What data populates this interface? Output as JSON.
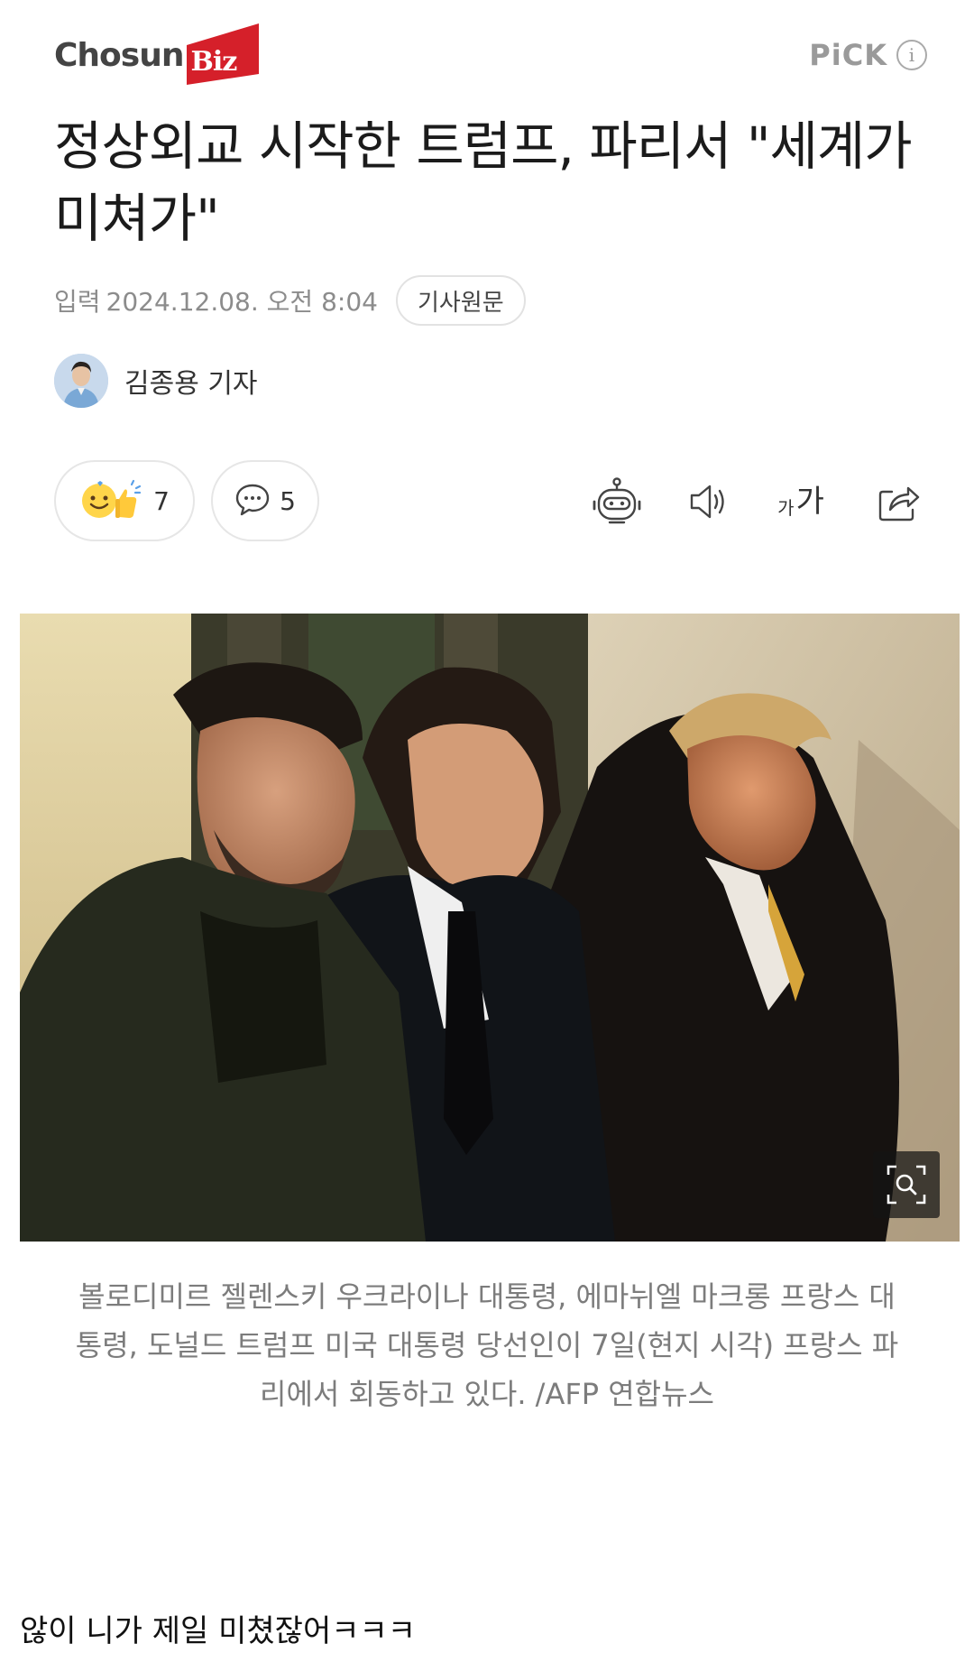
{
  "header": {
    "logo_text": "Chosun",
    "logo_biz": "Biz",
    "pick_label": "PiCK",
    "info_icon": "info-icon"
  },
  "article": {
    "headline": "정상외교 시작한 트럼프, 파리서 \"세계가 미쳐가\"",
    "date_label": "입력",
    "date_value": "2024.12.08. 오전 8:04",
    "original_button": "기사원문",
    "author": "김종용 기자",
    "reaction_count": "7",
    "comment_count": "5",
    "font_small": "가",
    "font_large": "가",
    "caption": "볼로디미르 젤렌스키 우크라이나 대통령, 에마뉘엘 마크롱 프랑스 대통령, 도널드 트럼프 미국 대통령 당선인이 7일(현지 시각) 프랑스 파리에서 회동하고 있다. /AFP 연합뉴스"
  },
  "user_comment": "않이 니가 제일 미쳤잖어ㅋㅋㅋ",
  "colors": {
    "brand_red": "#d5202a",
    "logo_gray": "#444444",
    "meta_gray": "#8c8c8c",
    "caption_gray": "#7c7c7c"
  },
  "icons": [
    "emoji-reaction-icon",
    "speech-bubble-icon",
    "robot-summary-icon",
    "speaker-icon",
    "font-size-icon",
    "share-icon",
    "zoom-icon"
  ]
}
